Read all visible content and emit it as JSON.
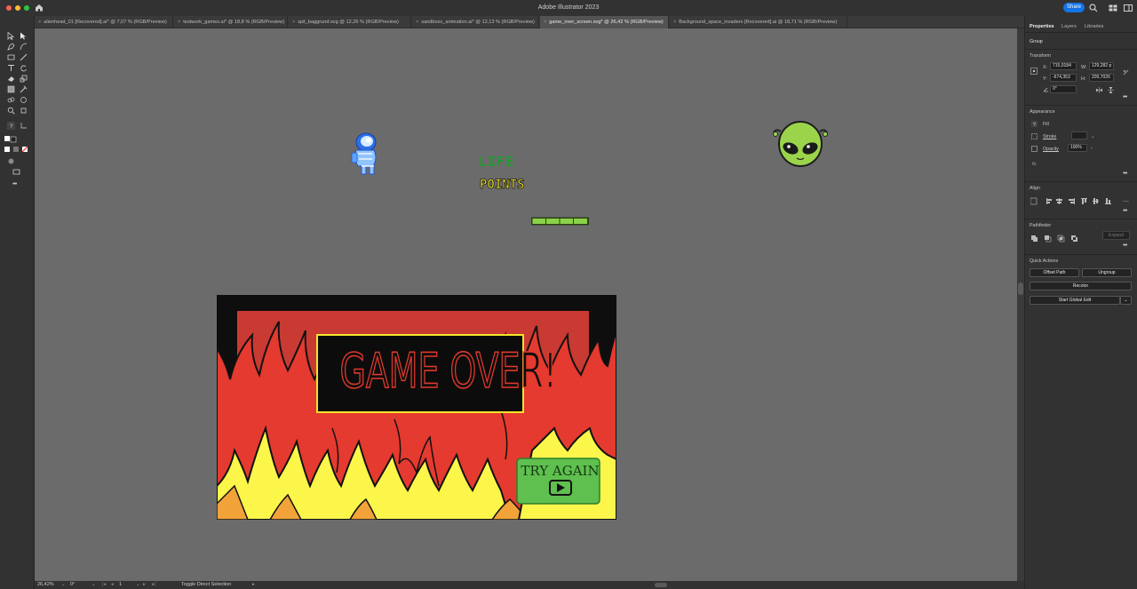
{
  "window": {
    "title": "Adobe Illustrator 2023",
    "traffic_colors": [
      "#fe5f57",
      "#febc2e",
      "#28c840"
    ],
    "share_label": "Share"
  },
  "tabs": [
    {
      "label": "alienhead_01 [Recovered].ai* @ 7,07 % (RGB/Preview)",
      "active": false
    },
    {
      "label": "testwork_games.ai* @ 18,8 % (RGB/Preview)",
      "active": false
    },
    {
      "label": "spil_baggrund.svg @ 12,26 % (RGB/Preview)",
      "active": false
    },
    {
      "label": "sandboxx_animation.ai* @ 12,13 % (RGB/Preview)",
      "active": false
    },
    {
      "label": "game_over_screen.svg* @ 26,42 % (RGB/Preview)",
      "active": true
    },
    {
      "label": "Background_space_invaders [Recovered].ai @ 18,71 % (RGB/Preview)",
      "active": false
    }
  ],
  "artboard": {
    "life_text": "LIFE",
    "points_text": "POINTS",
    "game_over_text": "GAME OVER!",
    "try_again_text": "TRY AGAIN",
    "colors": {
      "flame_red": "#e53a2f",
      "flame_dark": "#c93a33",
      "flame_yellow": "#fdf64a",
      "flame_orange": "#f1a33a",
      "title_red": "#e0392b",
      "button_green": "#5fbf4f",
      "lifebar_green": "#8bd24a",
      "alien_green": "#9bd44b"
    }
  },
  "panel": {
    "tabs": [
      "Properties",
      "Layers",
      "Libraries"
    ],
    "selection": "Group",
    "transform": {
      "title": "Transform",
      "x_label": "X:",
      "x_value": "715,0184",
      "y_label": "Y:",
      "y_value": "-674,353",
      "w_label": "W:",
      "w_value": "129,282 p",
      "h_label": "H:",
      "h_value": "209,7026",
      "angle_value": "0°"
    },
    "appearance": {
      "title": "Appearance",
      "fill_label": "Fill",
      "stroke_label": "Stroke",
      "opacity_label": "Opacity",
      "opacity_value": "100%",
      "fx_label": "fx."
    },
    "align": {
      "title": "Align"
    },
    "pathfinder": {
      "title": "Pathfinder",
      "expand_label": "Expand"
    },
    "quick_actions": {
      "title": "Quick Actions",
      "offset_path": "Offset Path",
      "ungroup": "Ungroup",
      "recolor": "Recolor",
      "start_global_edit": "Start Global Edit"
    }
  },
  "status": {
    "zoom": "26,42%",
    "rotation": "0°",
    "artboard_number": "1",
    "tool_hint": "Toggle Direct Selection"
  }
}
